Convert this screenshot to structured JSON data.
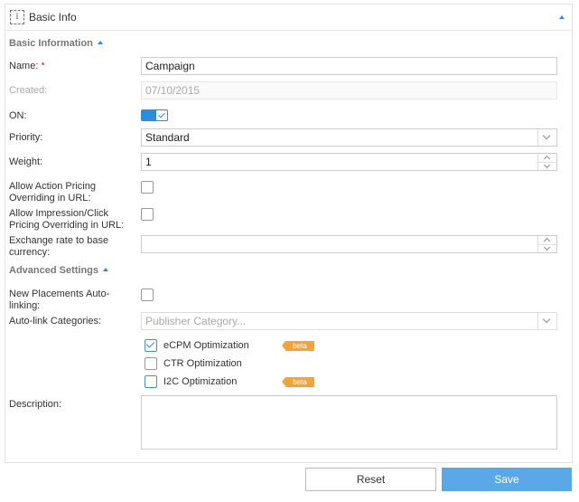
{
  "header": {
    "title": "Basic Info",
    "info_icon": "i"
  },
  "sections": {
    "basic": "Basic Information",
    "advanced": "Advanced Settings"
  },
  "fields": {
    "name": {
      "label": "Name:",
      "required_mark": "*",
      "value": "Campaign"
    },
    "created": {
      "label": "Created:",
      "value": "07/10/2015"
    },
    "on": {
      "label": "ON:",
      "checked": true
    },
    "priority": {
      "label": "Priority:",
      "value": "Standard"
    },
    "weight": {
      "label": "Weight:",
      "value": "1"
    },
    "allow_action_pricing": {
      "label_line1": "Allow Action Pricing",
      "label_line2": "Overriding in URL:",
      "checked": false
    },
    "allow_impression_pricing": {
      "label_line1": "Allow Impression/Click",
      "label_line2": "Pricing Overriding in URL:",
      "checked": false
    },
    "exchange_rate": {
      "label_line1": "Exchange rate to base",
      "label_line2": "currency:",
      "value": ""
    },
    "new_placements": {
      "label_line1": "New Placements Auto-",
      "label_line2": "linking:",
      "checked": false
    },
    "autolink_categories": {
      "label": "Auto-link Categories:",
      "placeholder": "Publisher Category..."
    },
    "optimizations": [
      {
        "label": "eCPM Optimization",
        "checked": true,
        "badge": "beta"
      },
      {
        "label": "CTR Optimization",
        "checked": false,
        "badge": ""
      },
      {
        "label": "I2C Optimization",
        "checked": false,
        "badge": "beta"
      }
    ],
    "description": {
      "label": "Description:",
      "value": ""
    }
  },
  "buttons": {
    "reset": "Reset",
    "save": "Save"
  },
  "colors": {
    "accent": "#2b8ed8",
    "save_button": "#5aa8e8",
    "beta_badge": "#f0a53a",
    "required": "#d9232d"
  }
}
